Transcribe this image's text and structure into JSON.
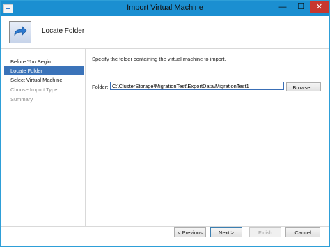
{
  "window": {
    "title": "Import Virtual Machine"
  },
  "titlebar": {
    "minimize": "—",
    "maximize": "☐",
    "close": "✕"
  },
  "header": {
    "title": "Locate Folder"
  },
  "sidebar": {
    "items": [
      {
        "label": "Before You Begin",
        "state": "normal"
      },
      {
        "label": "Locate Folder",
        "state": "active"
      },
      {
        "label": "Select Virtual Machine",
        "state": "normal"
      },
      {
        "label": "Choose Import Type",
        "state": "disabled"
      },
      {
        "label": "Summary",
        "state": "disabled"
      }
    ]
  },
  "main": {
    "instruction": "Specify the folder containing the virtual machine to import.",
    "folder_label": "Folder:",
    "folder_value": "C:\\ClusterStorage\\MigrationTest\\ExportData\\MigrationTest1",
    "browse_label": "Browse..."
  },
  "footer": {
    "previous_label": "< Previous",
    "next_label": "Next >",
    "finish_label": "Finish",
    "cancel_label": "Cancel"
  },
  "colors": {
    "titlebar": "#1b8fd1",
    "selected": "#3b73b9",
    "close": "#c7372f"
  }
}
